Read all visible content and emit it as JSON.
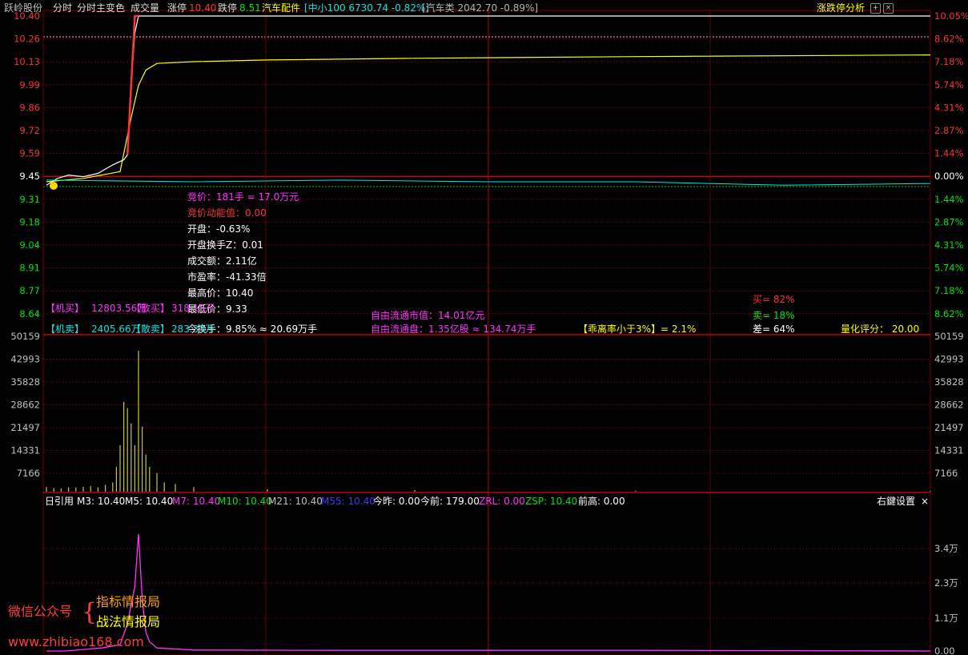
{
  "header": {
    "stock_name": "跃岭股份",
    "mode_1": "分时",
    "mode_2": "分时主变色",
    "volume_label": "成交量",
    "limit_up_label": "涨停",
    "limit_up_value": "10.40",
    "limit_down_label": "跌停",
    "limit_down_value": "8.51",
    "sector": "汽车配件",
    "index_1": "[中小100 6730.74 -0.82%]",
    "index_2": "[汽车类 2042.70 -0.89%]",
    "analysis_button": "涨跌停分析",
    "icon_add": "plus-square-icon",
    "icon_close": "close-square-icon"
  },
  "price_axis": {
    "left": [
      "10.40",
      "10.26",
      "10.13",
      "9.99",
      "9.86",
      "9.72",
      "9.59",
      "9.45",
      "9.31",
      "9.18",
      "9.04",
      "8.91",
      "8.77",
      "8.64"
    ],
    "right": [
      "10.05%",
      "8.62%",
      "7.18%",
      "5.74%",
      "4.31%",
      "2.87%",
      "1.44%",
      "0.00%",
      "1.44%",
      "2.87%",
      "4.31%",
      "5.74%",
      "7.18%",
      "8.62%"
    ]
  },
  "volume_axis": [
    "50159",
    "42993",
    "35828",
    "28662",
    "21497",
    "14331",
    "7166"
  ],
  "info_panel": {
    "bid": "竞价：181手 = 17.0万元",
    "bid_energy": "竞价动能值：0.00",
    "open": "开盘：-0.63%",
    "open_turnover": "开盘换手Z：0.01",
    "amount": "成交额：2.11亿",
    "pe": "市盈率：-41.33倍",
    "high": "最高价：10.40",
    "low": "最低价：9.33",
    "turnover": "今换手：9.85% ≈ 20.69万手",
    "inst_buy_tag": "【机买】",
    "inst_buy_val": "12803.56万",
    "retail_buy_tag": "【散买】",
    "retail_buy_val": "318.15万",
    "inst_sell_tag": "【机卖】",
    "inst_sell_val": "2405.66万",
    "retail_sell_tag": "【散卖】",
    "retail_sell_val": "283.33万",
    "float_mv": "自由流通市值：14.01亿元",
    "float_shares": "自由流通盘：1.35亿股 ≈ 134.74万手",
    "deviation": "【乖离率小于3%】= 2.1%",
    "buy_pct": "买= 82%",
    "sell_pct": "卖= 18%",
    "diff_pct": "差= 64%",
    "score": "量化评分：  20.00"
  },
  "indicator_bar": {
    "name": "日引用",
    "m3": "M3: 10.40",
    "m5": "M5: 10.40",
    "m7": "M7: 10.40",
    "m10": "M10: 10.40",
    "m21": "M21: 10.40",
    "m55": "M55: 10.40",
    "zuo": "今昨: 0.00",
    "jin": "今前: 179.00",
    "zrl": "ZRL: 0.00",
    "zsp": "ZSP: 10.40",
    "qian": "前高: 0.00",
    "settings": "右鍵设置",
    "close": "×"
  },
  "lower_axis": [
    "3.4万",
    "2.3万",
    "1.1万",
    "0.00"
  ],
  "watermark": {
    "wechat": "微信公众号",
    "line1": "指标情报局",
    "line2": "战法情报局",
    "url": "www.zhibiao168.com"
  },
  "colors": {
    "up": "#ff3232",
    "down": "#00e600",
    "price_line": "#ffffff",
    "avg_line": "#ffff00",
    "volume": "#c8c832",
    "magenta": "#ff32ff",
    "cyan": "#00e6e6",
    "grid": "#8b0000"
  },
  "chart_data": {
    "type": "line",
    "title": "",
    "x": "minute index 0-240",
    "ylim": [
      8.51,
      10.4
    ],
    "prev_close": 9.45,
    "series": [
      {
        "name": "",
        "x": [
          0,
          3,
          6,
          10,
          14,
          18,
          21,
          22,
          23,
          24,
          25,
          26,
          27,
          30,
          40,
          60,
          100,
          160,
          240
        ],
        "values": [
          9.4,
          9.44,
          9.46,
          9.45,
          9.47,
          9.52,
          9.55,
          9.58,
          9.99,
          10.3,
          10.4,
          10.4,
          10.4,
          10.4,
          10.4,
          10.4,
          10.4,
          10.4,
          10.4
        ]
      },
      {
        "name": "",
        "x": [
          0,
          10,
          20,
          23,
          25,
          27,
          30,
          40,
          60,
          100,
          160,
          240
        ],
        "values": [
          9.42,
          9.44,
          9.48,
          9.8,
          9.99,
          10.08,
          10.12,
          10.13,
          10.14,
          10.15,
          10.16,
          10.17
        ]
      }
    ],
    "volume": {
      "x": [
        0,
        2,
        4,
        6,
        8,
        10,
        12,
        14,
        16,
        18,
        19,
        20,
        21,
        22,
        23,
        24,
        25,
        26,
        27,
        28,
        30,
        32,
        35,
        40,
        60,
        100,
        160,
        240
      ],
      "values": [
        1500,
        1200,
        1000,
        1400,
        1300,
        1600,
        1800,
        1400,
        2200,
        3000,
        8000,
        15000,
        29000,
        27000,
        22000,
        15000,
        45500,
        21000,
        12000,
        8000,
        6000,
        3000,
        2500,
        1500,
        800,
        500,
        300,
        200
      ],
      "ylim": [
        0,
        50159
      ]
    },
    "lower_indicator": {
      "x": [
        0,
        5,
        10,
        15,
        20,
        22,
        24,
        25,
        26,
        27,
        28,
        30,
        40,
        80,
        160,
        240
      ],
      "values": [
        0,
        0,
        500,
        1000,
        2000,
        9000,
        21000,
        38000,
        17000,
        6000,
        3000,
        1000,
        300,
        200,
        200,
        0
      ],
      "ylim": [
        0,
        45000
      ]
    }
  }
}
